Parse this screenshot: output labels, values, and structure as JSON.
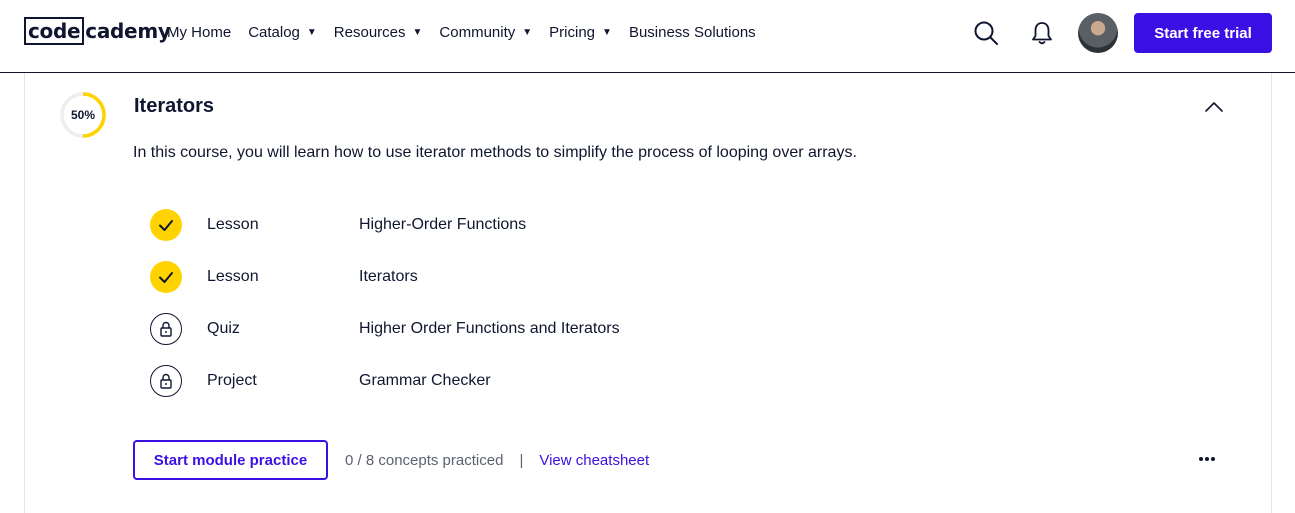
{
  "header": {
    "logo_boxed": "code",
    "logo_rest": "cademy",
    "nav": [
      {
        "label": "My Home",
        "has_caret": false
      },
      {
        "label": "Catalog",
        "has_caret": true
      },
      {
        "label": "Resources",
        "has_caret": true
      },
      {
        "label": "Community",
        "has_caret": true
      },
      {
        "label": "Pricing",
        "has_caret": true
      },
      {
        "label": "Business Solutions",
        "has_caret": false
      }
    ],
    "caret": "▼",
    "cta_label": "Start free trial",
    "icons": {
      "search": "search-icon",
      "notifications": "bell-icon",
      "avatar": "user-avatar"
    },
    "accent_color": "#3a10e5"
  },
  "module": {
    "progress_percent": 50,
    "progress_label": "50%",
    "progress_color": "#ffd300",
    "title": "Iterators",
    "description": "In this course, you will learn how to use iterator methods to simplify the process of looping over arrays.",
    "items": [
      {
        "status": "completed",
        "status_icon": "check-icon",
        "kind": "Lesson",
        "name": "Higher-Order Functions"
      },
      {
        "status": "completed",
        "status_icon": "check-icon",
        "kind": "Lesson",
        "name": "Iterators"
      },
      {
        "status": "locked",
        "status_icon": "lock-icon",
        "kind": "Quiz",
        "name": "Higher Order Functions and Iterators"
      },
      {
        "status": "locked",
        "status_icon": "lock-icon",
        "kind": "Project",
        "name": "Grammar Checker"
      }
    ],
    "practice_button_label": "Start module practice",
    "concepts_text": "0 / 8 concepts practiced",
    "separator": "|",
    "cheatsheet_label": "View cheatsheet",
    "collapse_icon": "chevron-up-icon",
    "more_icon": "more-options-icon"
  }
}
